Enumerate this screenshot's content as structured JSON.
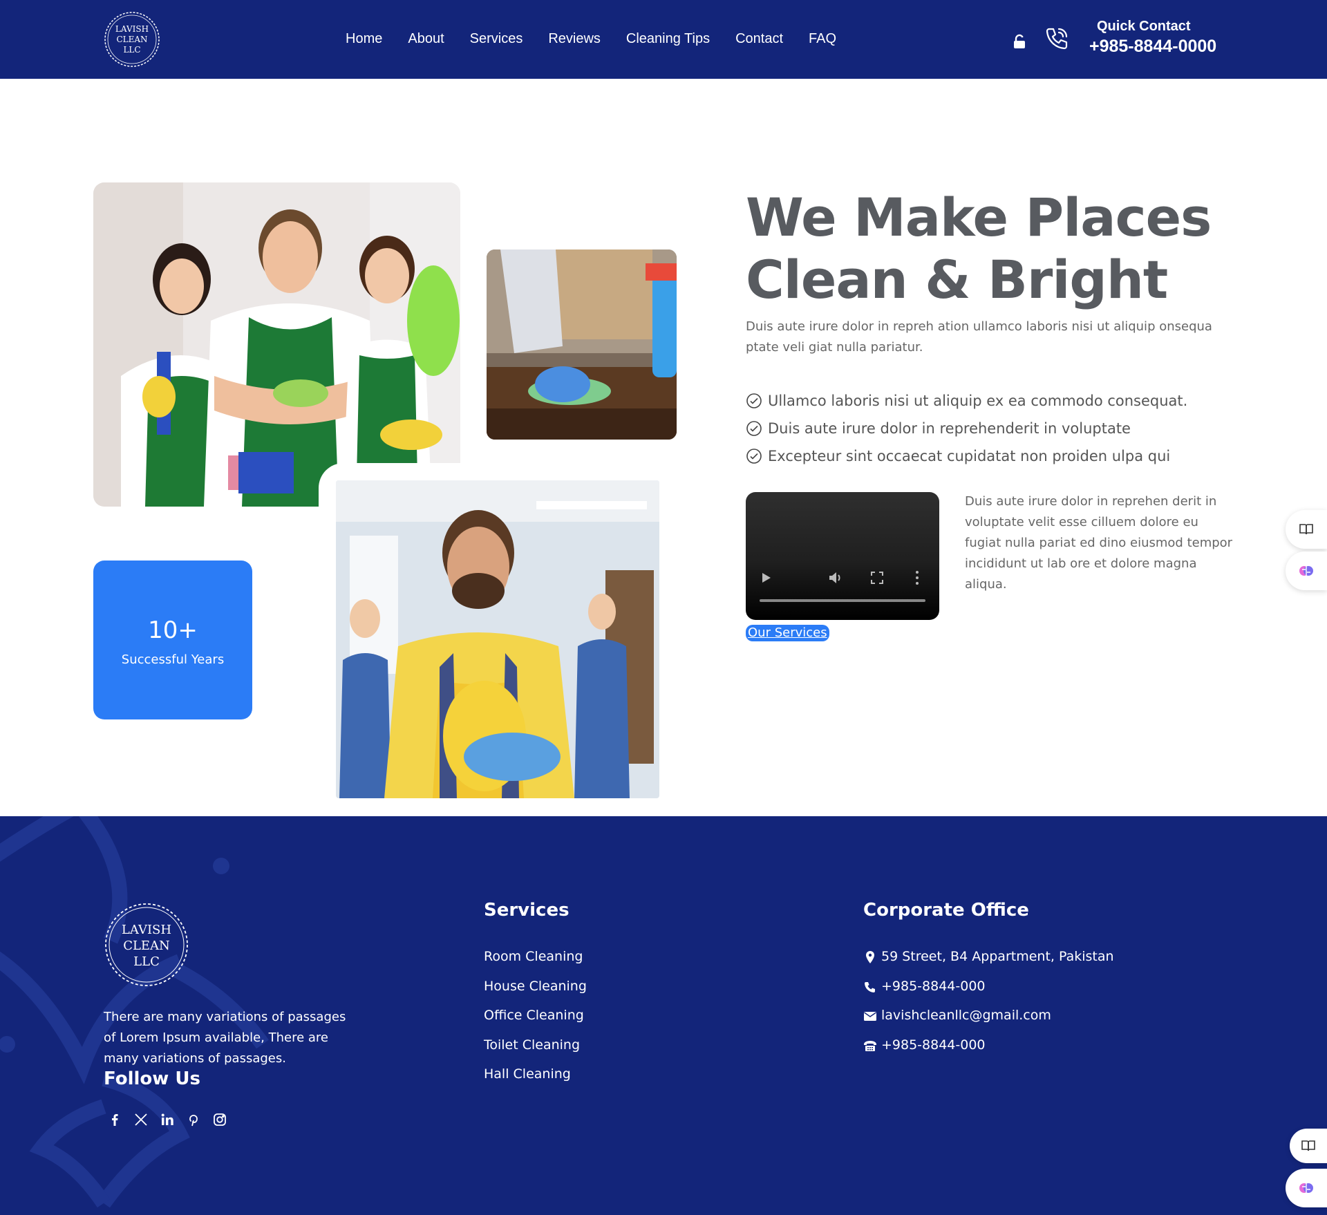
{
  "header": {
    "logo_text": [
      "LAVISH",
      "CLEAN",
      "LLC"
    ],
    "nav": [
      "Home",
      "About",
      "Services",
      "Reviews",
      "Cleaning Tips",
      "Contact",
      "FAQ"
    ],
    "quick_contact_label": "Quick Contact",
    "quick_contact_phone": "+985-8844-0000"
  },
  "hero": {
    "title_line1": "We Make Places",
    "title_line2": "Clean & Bright",
    "subtitle": "Duis aute irure dolor in repreh ation ullamco laboris nisi ut aliquip onsequa ptate veli giat nulla pariatur.",
    "checklist": [
      "Ullamco laboris nisi ut aliquip ex ea commodo consequat.",
      "Duis aute irure dolor in reprehenderit in voluptate",
      "Excepteur sint occaecat cupidatat non proiden ulpa qui"
    ],
    "video_description": "Duis aute irure dolor in reprehen derit in voluptate velit esse cilluem dolore eu fugiat nulla pariat ed dino eiusmod tempor incididunt ut lab ore et dolore magna aliqua.",
    "cta_label": "Our Services",
    "stat_number": "10+",
    "stat_label": "Successful Years"
  },
  "footer": {
    "logo_text": [
      "LAVISH",
      "CLEAN",
      "LLC"
    ],
    "about_text": "There are many variations of passages of Lorem Ipsum available, There are many variations of passages.",
    "follow_title": "Follow Us",
    "social": [
      "facebook-icon",
      "x-icon",
      "linkedin-icon",
      "pinterest-icon",
      "instagram-icon"
    ],
    "services_title": "Services",
    "services": [
      "Room Cleaning",
      "House Cleaning",
      "Office Cleaning",
      "Toilet Cleaning",
      "Hall Cleaning"
    ],
    "office_title": "Corporate Office",
    "office_items": [
      {
        "icon": "location-pin-icon",
        "text": "59 Street, B4 Appartment, Pakistan"
      },
      {
        "icon": "phone-icon",
        "text": "+985-8844-000"
      },
      {
        "icon": "envelope-icon",
        "text": "lavishcleanllc@gmail.com"
      },
      {
        "icon": "fax-icon",
        "text": "+985-8844-000"
      }
    ]
  },
  "colors": {
    "navy": "#13257a",
    "accent_blue": "#2b7cf6",
    "heading_gray": "#585b60"
  }
}
